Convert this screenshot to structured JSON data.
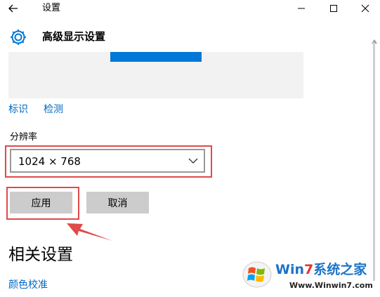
{
  "window": {
    "title": "设置",
    "back_icon": "back-arrow-icon",
    "minimize_icon": "minimize-icon",
    "maximize_icon": "maximize-icon",
    "close_icon": "close-icon"
  },
  "header": {
    "icon": "gear-icon",
    "title": "高级显示设置"
  },
  "display": {
    "identify_link": "标识",
    "detect_link": "检测",
    "accent_color": "#0078d7"
  },
  "resolution": {
    "label": "分辨率",
    "selected": "1024 × 768"
  },
  "actions": {
    "apply_label": "应用",
    "cancel_label": "取消"
  },
  "related": {
    "title": "相关设置",
    "color_calibration_link": "颜色校准"
  },
  "watermark": {
    "brand_win": "Win",
    "brand_seven": "7",
    "brand_suffix": "系统之家",
    "url": "Www.Winwin7.com"
  },
  "colors": {
    "link": "#0067c0",
    "highlight_box": "#e04a4a",
    "button_bg": "#cccccc"
  }
}
